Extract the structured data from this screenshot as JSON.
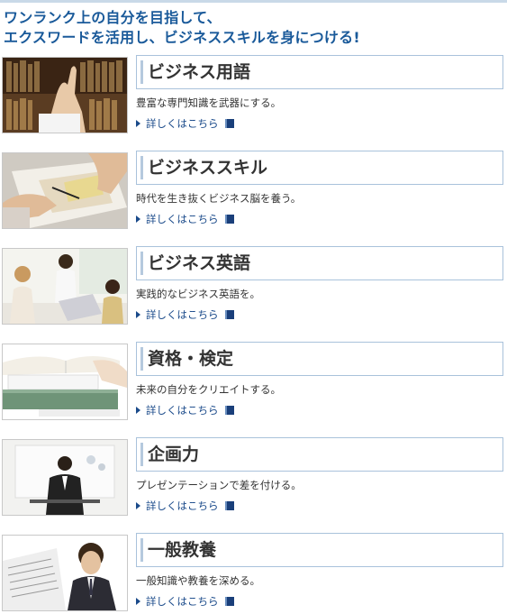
{
  "header": {
    "line1": "ワンランク上の自分を目指して、",
    "line2": "エクスワードを活用し、ビジネススキルを身につける!"
  },
  "colors": {
    "heading_blue": "#1a5a9a",
    "link_blue": "#1a4a8a",
    "title_border": "#a9c2db"
  },
  "items": [
    {
      "title": "ビジネス用語",
      "desc": "豊富な専門知識を武器にする。",
      "link": "詳しくはこちら",
      "icon": "book-icon"
    },
    {
      "title": "ビジネススキル",
      "desc": "時代を生き抜くビジネス脳を養う。",
      "link": "詳しくはこちら",
      "icon": "book-icon"
    },
    {
      "title": "ビジネス英語",
      "desc": "実践的なビジネス英語を。",
      "link": "詳しくはこちら",
      "icon": "book-icon"
    },
    {
      "title": "資格・検定",
      "desc": "未来の自分をクリエイトする。",
      "link": "詳しくはこちら",
      "icon": "book-icon"
    },
    {
      "title": "企画力",
      "desc": "プレゼンテーションで差を付ける。",
      "link": "詳しくはこちら",
      "icon": "book-icon"
    },
    {
      "title": "一般教養",
      "desc": "一般知識や教養を深める。",
      "link": "詳しくはこちら",
      "icon": "book-icon"
    }
  ]
}
